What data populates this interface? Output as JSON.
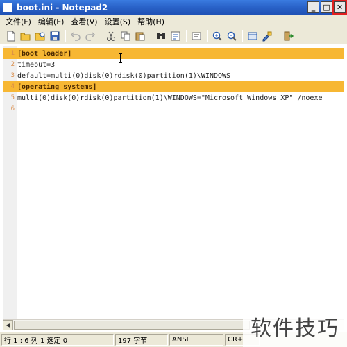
{
  "window": {
    "title": "boot.ini - Notepad2",
    "minimize_glyph": "_",
    "maximize_glyph": "□",
    "close_glyph": "✕"
  },
  "menu": [
    {
      "label": "文件(F)"
    },
    {
      "label": "编辑(E)"
    },
    {
      "label": "查看(V)"
    },
    {
      "label": "设置(S)"
    },
    {
      "label": "帮助(H)"
    }
  ],
  "toolbar": {
    "buttons": [
      "new-icon",
      "open-icon",
      "browse-icon",
      "save-icon",
      "undo-icon",
      "redo-icon",
      "cut-icon",
      "copy-icon",
      "paste-icon",
      "find-icon",
      "replace-icon",
      "word-wrap-icon",
      "zoom-in-icon",
      "zoom-out-icon",
      "view-icon",
      "settings-icon",
      "exit-icon"
    ]
  },
  "editor": {
    "lines": [
      {
        "no": "1",
        "text": "[boot loader]",
        "section": true
      },
      {
        "no": "2",
        "text": "timeout=3",
        "section": false
      },
      {
        "no": "3",
        "text": "default=multi(0)disk(0)rdisk(0)partition(1)\\WINDOWS",
        "section": false
      },
      {
        "no": "4",
        "text": "[operating systems]",
        "section": true
      },
      {
        "no": "5",
        "text": "multi(0)disk(0)rdisk(0)partition(1)\\WINDOWS=\"Microsoft Windows XP\" /noexe",
        "section": false
      },
      {
        "no": "6",
        "text": "",
        "section": false
      }
    ],
    "section_color": "#f7b733",
    "line_number_color": "#d98c4a"
  },
  "statusbar": {
    "position": "行 1 : 6   列 1   选定 0",
    "size": "197 字节",
    "encoding": "ANSI",
    "eol": "CR+"
  },
  "watermark": "软件技巧"
}
